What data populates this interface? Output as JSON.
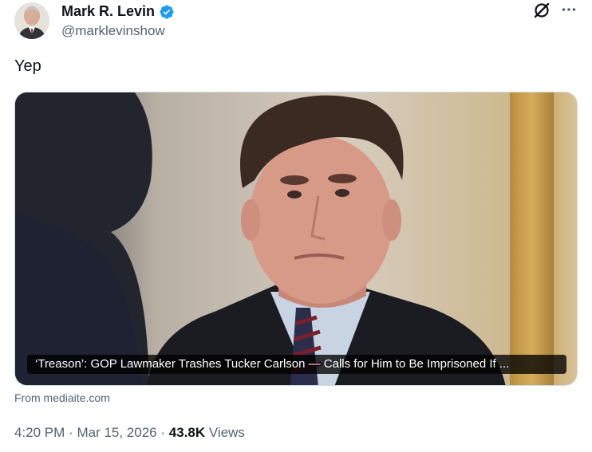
{
  "author": {
    "display_name": "Mark R. Levin",
    "handle": "@marklevinshow",
    "verified_icon": "verified-badge-icon"
  },
  "actions": {
    "grok_icon": "grok-icon",
    "more_icon": "more-options-icon"
  },
  "tweet": {
    "text": "Yep"
  },
  "card": {
    "headline": "‘Treason’: GOP Lawmaker Trashes Tucker Carlson — Calls for Him to Be Imprisoned If ...",
    "source": "From mediaite.com"
  },
  "meta": {
    "time": "4:20 PM",
    "date": "Mar 15, 2026",
    "views_count": "43.8K",
    "views_label": "Views",
    "separator": "·"
  },
  "colors": {
    "verified_blue": "#1d9bf0",
    "secondary_text": "#536471",
    "primary_text": "#0f1419"
  }
}
